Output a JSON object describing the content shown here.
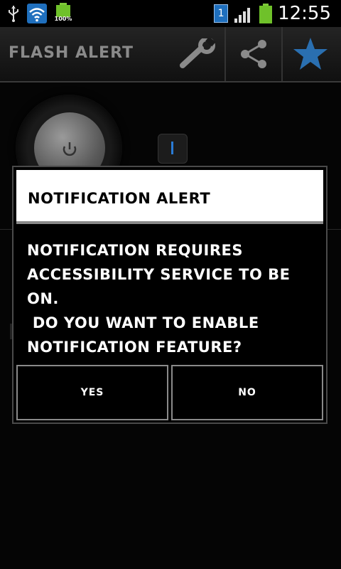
{
  "status_bar": {
    "icons": [
      "usb-icon",
      "wifi-icon",
      "battery-icon",
      "notification-badge-icon",
      "signal-icon",
      "battery-icon"
    ],
    "battery_percent": "100%",
    "notification_count": "1",
    "time": "12:55"
  },
  "action_bar": {
    "title": "FLASH ALERT",
    "actions": [
      "wrench-icon",
      "share-icon",
      "star-icon"
    ],
    "star_color": "#2a6fb0"
  },
  "dialog": {
    "title": "NOTIFICATION ALERT",
    "message": "NOTIFICATION REQUIRES ACCESSIBILITY SERVICE TO BE ON.\n DO YOU WANT TO ENABLE NOTIFICATION FEATURE?",
    "yes_label": "YES",
    "no_label": "NO"
  }
}
